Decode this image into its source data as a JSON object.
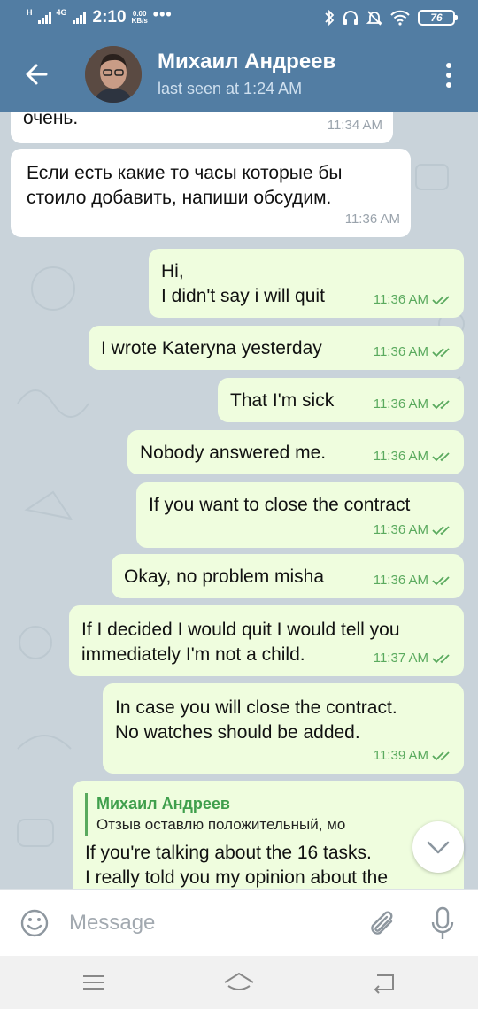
{
  "status_bar": {
    "network_label": "H",
    "network2_label": "4G",
    "time": "2:10",
    "speed_value": "0.00",
    "speed_unit": "KB/s",
    "more": "•••",
    "battery": "76"
  },
  "header": {
    "contact_name": "Михаил Андреев",
    "last_seen": "last seen at 1:24 AM",
    "color": "#527da3"
  },
  "messages": [
    {
      "direction": "in",
      "text": "очень.",
      "time": "11:34 AM"
    },
    {
      "direction": "in",
      "text": "Если есть какие то часы которые бы\nстоило добавить, напиши обсудим.",
      "time": "11:36 AM"
    },
    {
      "direction": "out",
      "text": "Hi,\nI didn't say i will quit",
      "time": "11:36 AM",
      "read": true
    },
    {
      "direction": "out",
      "text": "I wrote Kateryna yesterday",
      "time": "11:36 AM",
      "read": true
    },
    {
      "direction": "out",
      "text": "That I'm sick",
      "time": "11:36 AM",
      "read": true
    },
    {
      "direction": "out",
      "text": "Nobody answered me.",
      "time": "11:36 AM",
      "read": true
    },
    {
      "direction": "out",
      "text": "If you want to close the contract",
      "time": "11:36 AM",
      "read": true
    },
    {
      "direction": "out",
      "text": "Okay, no problem misha",
      "time": "11:36 AM",
      "read": true
    },
    {
      "direction": "out",
      "text": "If I decided I would quit I would tell you\nimmediately I'm not a child.",
      "time": "11:37 AM",
      "read": true
    },
    {
      "direction": "out",
      "text": "In case you will close the contract.\nNo watches should be added.",
      "time": "11:39 AM",
      "read": true
    },
    {
      "direction": "out",
      "reply_to_name": "Михаил Андреев",
      "reply_to_text": "Отзыв оставлю положительный, мо",
      "text": "If you're talking about the 16 tasks.\nI really told you my opinion about the"
    }
  ],
  "input": {
    "placeholder": "Message"
  },
  "icons": {
    "back": "arrow-left-icon",
    "menu": "more-vertical-icon",
    "emoji": "smile-icon",
    "attach": "paperclip-icon",
    "mic": "microphone-icon",
    "scroll": "chevron-down-icon"
  },
  "colors": {
    "incoming_bubble": "#ffffff",
    "outgoing_bubble": "#effdde",
    "outgoing_meta": "#5aaa5e",
    "chat_background": "#c9d3da"
  }
}
